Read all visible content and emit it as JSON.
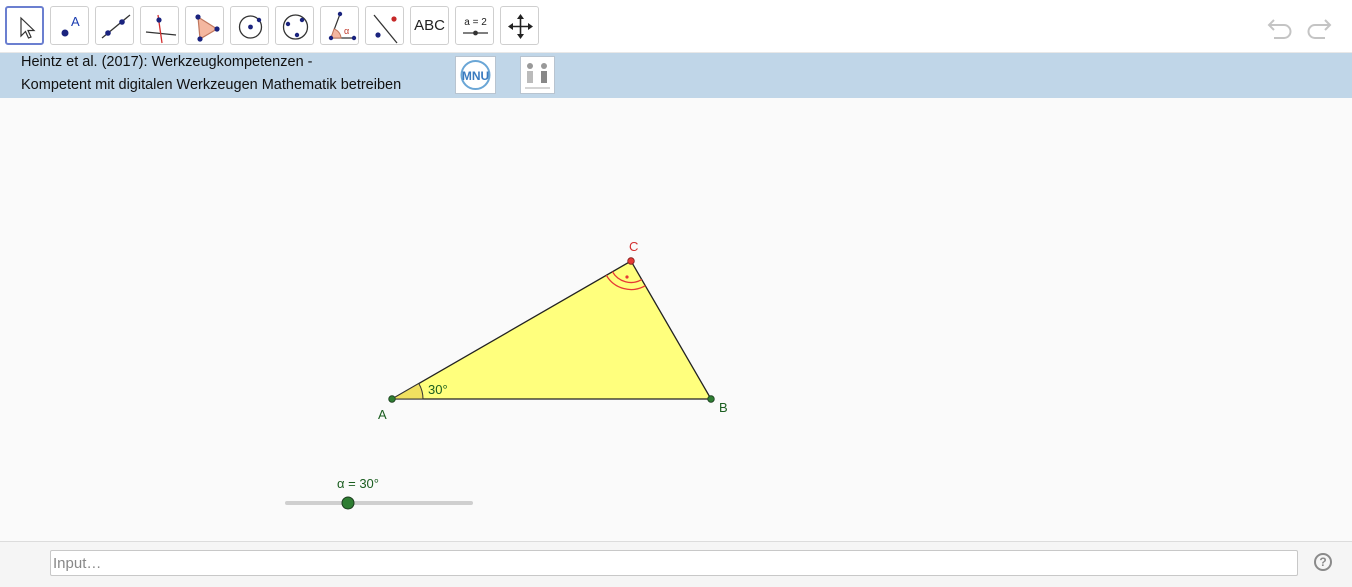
{
  "toolbar": {
    "tools": [
      {
        "name": "move-tool"
      },
      {
        "name": "point-tool",
        "glyph": "A"
      },
      {
        "name": "line-tool"
      },
      {
        "name": "perpendicular-line-tool"
      },
      {
        "name": "polygon-tool"
      },
      {
        "name": "circle-center-point-tool"
      },
      {
        "name": "circle-three-points-tool"
      },
      {
        "name": "angle-tool",
        "glyph": "α"
      },
      {
        "name": "reflect-tool"
      },
      {
        "name": "text-tool",
        "label": "ABC"
      },
      {
        "name": "slider-tool",
        "label": "a = 2"
      },
      {
        "name": "move-graphics-view-tool"
      }
    ]
  },
  "banner": {
    "line1": "Heintz et al. (2017): Werkzeugkompetenzen -",
    "line2": "Kompetent mit digitalen Werkzeugen Mathematik betreiben",
    "logo1_text": "MNU"
  },
  "construction": {
    "points": {
      "A": "A",
      "B": "B",
      "C": "C"
    },
    "angle_label": "30°",
    "slider_label": "α = 30°",
    "slider_value_deg": 30,
    "colors": {
      "polygon_fill": "#ffff66",
      "point_green": "#2e7d32",
      "point_red": "#e53935",
      "label_green": "#1b5e20",
      "label_red": "#d32f2f"
    }
  },
  "inputbar": {
    "placeholder": "Input…",
    "help_glyph": "?"
  }
}
